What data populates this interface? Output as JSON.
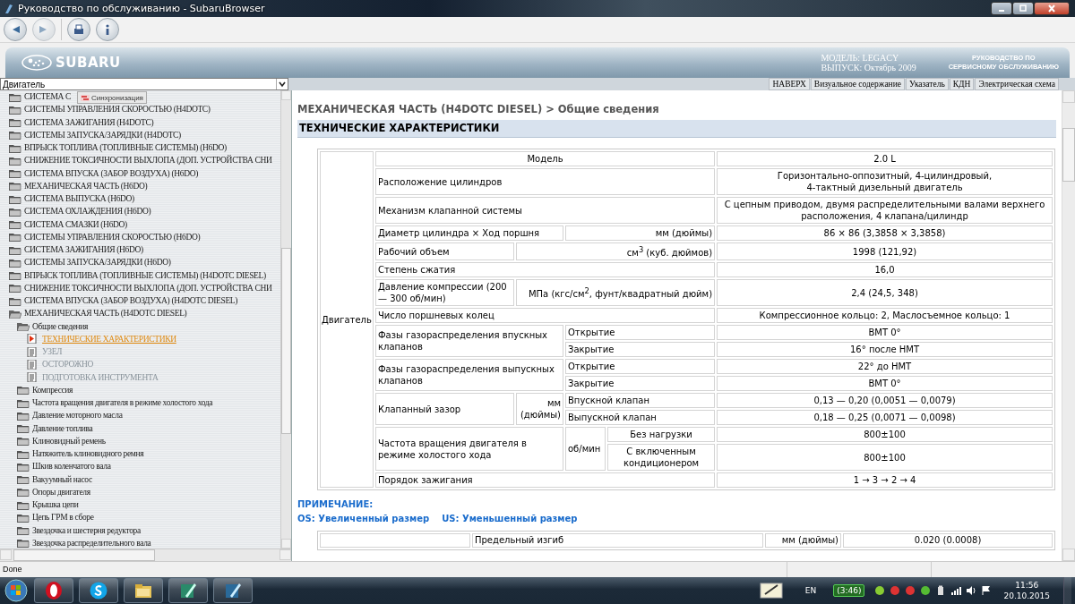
{
  "window": {
    "title": "Руководство по обслуживанию - SubaruBrowser"
  },
  "toolbar": [
    {
      "kind": "back",
      "disabled": false
    },
    {
      "kind": "forward",
      "disabled": true
    },
    {
      "kind": "print",
      "disabled": false
    },
    {
      "kind": "info",
      "disabled": false
    }
  ],
  "banner": {
    "logo": "SUBARU",
    "model": "МОДЕЛЬ: LEGACY",
    "release": "ВЫПУСК: Октябрь 2009",
    "manual": [
      "РУКОВОДСТВО ПО",
      "СЕРВИСНОМУ ОБСЛУЖИВАНИЮ"
    ]
  },
  "section_select": {
    "value": "Двигатель"
  },
  "nav_buttons": [
    "НАВЕРХ",
    "Визуальное содержание",
    "Указатель",
    "КДН",
    "Электрическая схема"
  ],
  "tree": {
    "items": [
      {
        "label": "СИСТЕМА С",
        "kind": "folder",
        "expanded": false
      },
      {
        "label": "СИСТЕМЫ УПРАВЛЕНИЯ СКОРОСТЬЮ (H4DOTC)",
        "kind": "folder",
        "expanded": false
      },
      {
        "label": "СИСТЕМА ЗАЖИГАНИЯ (H4DOTC)",
        "kind": "folder",
        "expanded": false
      },
      {
        "label": "СИСТЕМЫ ЗАПУСКА/ЗАРЯДКИ (H4DOTC)",
        "kind": "folder",
        "expanded": false
      },
      {
        "label": "ВПРЫСК ТОПЛИВА (ТОПЛИВНЫЕ СИСТЕМЫ) (H6DO)",
        "kind": "folder",
        "expanded": false
      },
      {
        "label": "СНИЖЕНИЕ ТОКСИЧНОСТИ ВЫХЛОПА (ДОП. УСТРОЙСТВА СНИ",
        "kind": "folder",
        "expanded": false
      },
      {
        "label": "СИСТЕМА ВПУСКА (ЗАБОР ВОЗДУХА) (H6DO)",
        "kind": "folder",
        "expanded": false
      },
      {
        "label": "МЕХАНИЧЕСКАЯ ЧАСТЬ (H6DO)",
        "kind": "folder",
        "expanded": false
      },
      {
        "label": "СИСТЕМА ВЫПУСКА (H6DO)",
        "kind": "folder",
        "expanded": false
      },
      {
        "label": "СИСТЕМА ОХЛАЖДЕНИЯ (H6DO)",
        "kind": "folder",
        "expanded": false
      },
      {
        "label": "СИСТЕМА СМАЗКИ (H6DO)",
        "kind": "folder",
        "expanded": false
      },
      {
        "label": "СИСТЕМЫ УПРАВЛЕНИЯ СКОРОСТЬЮ (H6DO)",
        "kind": "folder",
        "expanded": false
      },
      {
        "label": "СИСТЕМА ЗАЖИГАНИЯ (H6DO)",
        "kind": "folder",
        "expanded": false
      },
      {
        "label": "СИСТЕМЫ ЗАПУСКА/ЗАРЯДКИ (H6DO)",
        "kind": "folder",
        "expanded": false
      },
      {
        "label": "ВПРЫСК ТОПЛИВА (ТОПЛИВНЫЕ СИСТЕМЫ) (H4DOTC DIESEL)",
        "kind": "folder",
        "expanded": false
      },
      {
        "label": "СНИЖЕНИЕ ТОКСИЧНОСТИ ВЫХЛОПА (ДОП. УСТРОЙСТВА СНИ",
        "kind": "folder",
        "expanded": false
      },
      {
        "label": "СИСТЕМА ВПУСКА (ЗАБОР ВОЗДУХА) (H4DOTC DIESEL)",
        "kind": "folder",
        "expanded": false
      },
      {
        "label": "МЕХАНИЧЕСКАЯ ЧАСТЬ (H4DOTC DIESEL)",
        "kind": "folder",
        "expanded": true,
        "children": [
          {
            "label": "Общие сведения",
            "kind": "folder",
            "expanded": true,
            "children": [
              {
                "label": "ТЕХНИЧЕСКИЕ ХАРАКТЕРИСТИКИ",
                "kind": "page",
                "selected": true,
                "disabled": false
              },
              {
                "label": "УЗЕЛ",
                "kind": "page",
                "selected": false,
                "disabled": true
              },
              {
                "label": "ОСТОРОЖНО",
                "kind": "page",
                "selected": false,
                "disabled": true
              },
              {
                "label": "ПОДГОТОВКА ИНСТРУМЕНТА",
                "kind": "page",
                "selected": false,
                "disabled": true
              }
            ]
          },
          {
            "label": "Компрессия",
            "kind": "folder",
            "expanded": false
          },
          {
            "label": "Частота вращения двигателя в режиме холостого хода",
            "kind": "folder",
            "expanded": false
          },
          {
            "label": "Давление моторного масла",
            "kind": "folder",
            "expanded": false
          },
          {
            "label": "Давление топлива",
            "kind": "folder",
            "expanded": false
          },
          {
            "label": "Клиновидный ремень",
            "kind": "folder",
            "expanded": false
          },
          {
            "label": "Натяжитель клиновидного ремня",
            "kind": "folder",
            "expanded": false
          },
          {
            "label": "Шкив коленчатого вала",
            "kind": "folder",
            "expanded": false
          },
          {
            "label": "Вакуумный насос",
            "kind": "folder",
            "expanded": false
          },
          {
            "label": "Опоры двигателя",
            "kind": "folder",
            "expanded": false
          },
          {
            "label": "Крышка цепи",
            "kind": "folder",
            "expanded": false
          },
          {
            "label": "Цепь ГРМ в сборе",
            "kind": "folder",
            "expanded": false
          },
          {
            "label": "Звездочка и шестерня редуктора",
            "kind": "folder",
            "expanded": false
          },
          {
            "label": "Звездочка распределительного вала",
            "kind": "folder",
            "expanded": false
          }
        ]
      }
    ]
  },
  "tooltip": "Синхронизация",
  "content": {
    "breadcrumb": "МЕХАНИЧЕСКАЯ ЧАСТЬ (H4DOTC DIESEL) > Общие сведения",
    "heading": "ТЕХНИЧЕСКИЕ ХАРАКТЕРИСТИКИ",
    "spec_table": {
      "rows": [
        [
          {
            "text": "Двигатель",
            "kind": "label",
            "rowspan": 17
          },
          {
            "text": "Модель",
            "kind": "value",
            "colspan": 4
          },
          {
            "text": "2.0 L",
            "kind": "value"
          }
        ],
        [
          {
            "text": "Расположение цилиндров",
            "kind": "label",
            "colspan": 4
          },
          {
            "text": "Горизонтально-оппозитный, 4-цилиндровый,\n4-тактный дизельный двигатель",
            "kind": "value"
          }
        ],
        [
          {
            "text": "Механизм клапанной системы",
            "kind": "label",
            "colspan": 4
          },
          {
            "text": "С цепным приводом, двумя распределительными валами верхнего\nрасположения, 4 клапана/цилиндр",
            "kind": "value"
          }
        ],
        [
          {
            "text": "Диаметр цилиндра × Ход поршня",
            "kind": "label",
            "colspan": 2
          },
          {
            "text": "мм (дюймы)",
            "kind": "unit",
            "colspan": 2
          },
          {
            "text": "86 × 86 (3,3858 × 3,3858)",
            "kind": "value"
          }
        ],
        [
          {
            "text": "Рабочий объем",
            "kind": "label"
          },
          {
            "text": "см$^{3}$ (куб. дюймов)",
            "kind": "unit",
            "colspan": 3
          },
          {
            "text": "1998 (121,92)",
            "kind": "value"
          }
        ],
        [
          {
            "text": "Степень сжатия",
            "kind": "label",
            "colspan": 4
          },
          {
            "text": "16,0",
            "kind": "value"
          }
        ],
        [
          {
            "text": "Давление компрессии (200 — 300 об/мин)",
            "kind": "label"
          },
          {
            "text": "МПа (кгс/см$^{2}$, фунт/квадратный дюйм)",
            "kind": "unit",
            "colspan": 3
          },
          {
            "text": "2,4 (24,5, 348)",
            "kind": "value"
          }
        ],
        [
          {
            "text": "Число поршневых колец",
            "kind": "label",
            "colspan": 4
          },
          {
            "text": "Компрессионное кольцо: 2, Маслосъемное кольцо: 1",
            "kind": "value"
          }
        ],
        [
          {
            "text": "Фазы газораспределения впускных клапанов",
            "kind": "label",
            "colspan": 2,
            "rowspan": 2
          },
          {
            "text": "Открытие",
            "kind": "label",
            "colspan": 2
          },
          {
            "text": "ВМТ 0°",
            "kind": "value"
          }
        ],
        [
          {
            "text": "Закрытие",
            "kind": "label",
            "colspan": 2
          },
          {
            "text": "16° после НМТ",
            "kind": "value"
          }
        ],
        [
          {
            "text": "Фазы газораспределения выпускных клапанов",
            "kind": "label",
            "colspan": 2,
            "rowspan": 2
          },
          {
            "text": "Открытие",
            "kind": "label",
            "colspan": 2
          },
          {
            "text": "22° до НМТ",
            "kind": "value"
          }
        ],
        [
          {
            "text": "Закрытие",
            "kind": "label",
            "colspan": 2
          },
          {
            "text": "ВМТ 0°",
            "kind": "value"
          }
        ],
        [
          {
            "text": "Клапанный зазор",
            "kind": "label",
            "rowspan": 2
          },
          {
            "text": "мм (дюймы)",
            "kind": "unit",
            "rowspan": 2
          },
          {
            "text": "Впускной клапан",
            "kind": "label",
            "colspan": 2
          },
          {
            "text": "0,13 — 0,20 (0,0051 — 0,0079)",
            "kind": "value"
          }
        ],
        [
          {
            "text": "Выпускной клапан",
            "kind": "label",
            "colspan": 2
          },
          {
            "text": "0,18 — 0,25 (0,0071 — 0,0098)",
            "kind": "value"
          }
        ],
        [
          {
            "text": "Частота вращения двигателя в режиме холостого хода",
            "kind": "label",
            "colspan": 2,
            "rowspan": 2
          },
          {
            "text": "об/мин",
            "kind": "label",
            "rowspan": 2
          },
          {
            "text": "Без нагрузки",
            "kind": "value"
          },
          {
            "text": "800±100",
            "kind": "value"
          }
        ],
        [
          {
            "text": "С включенным кондиционером",
            "kind": "value"
          },
          {
            "text": "800±100",
            "kind": "value"
          }
        ],
        [
          {
            "text": "Порядок зажигания",
            "kind": "label",
            "colspan": 4
          },
          {
            "text": "1 → 3 → 2 → 4",
            "kind": "value"
          }
        ]
      ]
    },
    "note": {
      "title": "ПРИМЕЧАНИЕ:",
      "items": [
        "OS: Увеличенный размер",
        "US: Уменьшенный размер"
      ]
    },
    "second_table": {
      "rows": [
        [
          {
            "text": "Предельный изгиб",
            "kind": "label"
          },
          {
            "text": "мм (дюймы)",
            "kind": "unit"
          },
          {
            "text": "0.020 (0.0008)",
            "kind": "value"
          }
        ]
      ]
    }
  },
  "status_bar": {
    "text": "Done"
  },
  "taskbar": {
    "language": "EN",
    "battery": "(3:46)",
    "time": "11:56",
    "date": "20.10.2015"
  }
}
